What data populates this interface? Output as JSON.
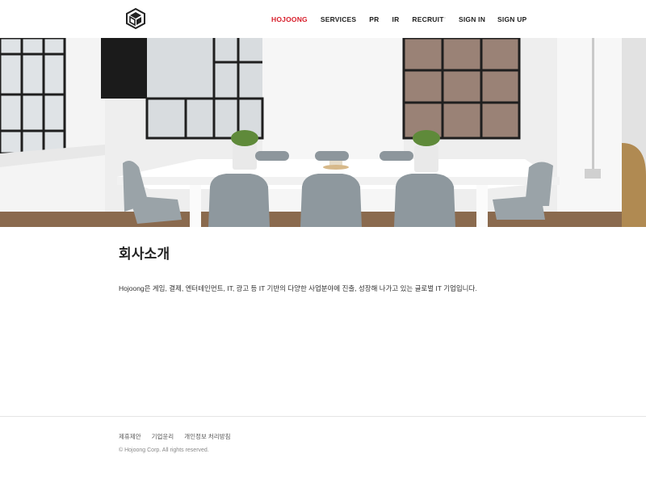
{
  "nav": {
    "items": [
      {
        "label": "HOJOONG"
      },
      {
        "label": "SERVICES"
      },
      {
        "label": "PR"
      },
      {
        "label": "IR"
      },
      {
        "label": "RECRUIT"
      }
    ],
    "active_color": "#d81e2b",
    "sign_in": "SIGN IN",
    "sign_up": "SIGN UP"
  },
  "main": {
    "title": "회사소개",
    "description": "Hojoong은 게임, 결제, 엔터테인먼트, IT, 광고 등 IT 기반의 다양한 사업분야에 진출, 성장해 나가고 있는 글로벌 IT 기업입니다."
  },
  "footer": {
    "links": [
      "제휴제안",
      "기업윤리",
      "개인정보 처리방침"
    ],
    "copyright": "© Hojoong Corp. All rights reserved."
  }
}
